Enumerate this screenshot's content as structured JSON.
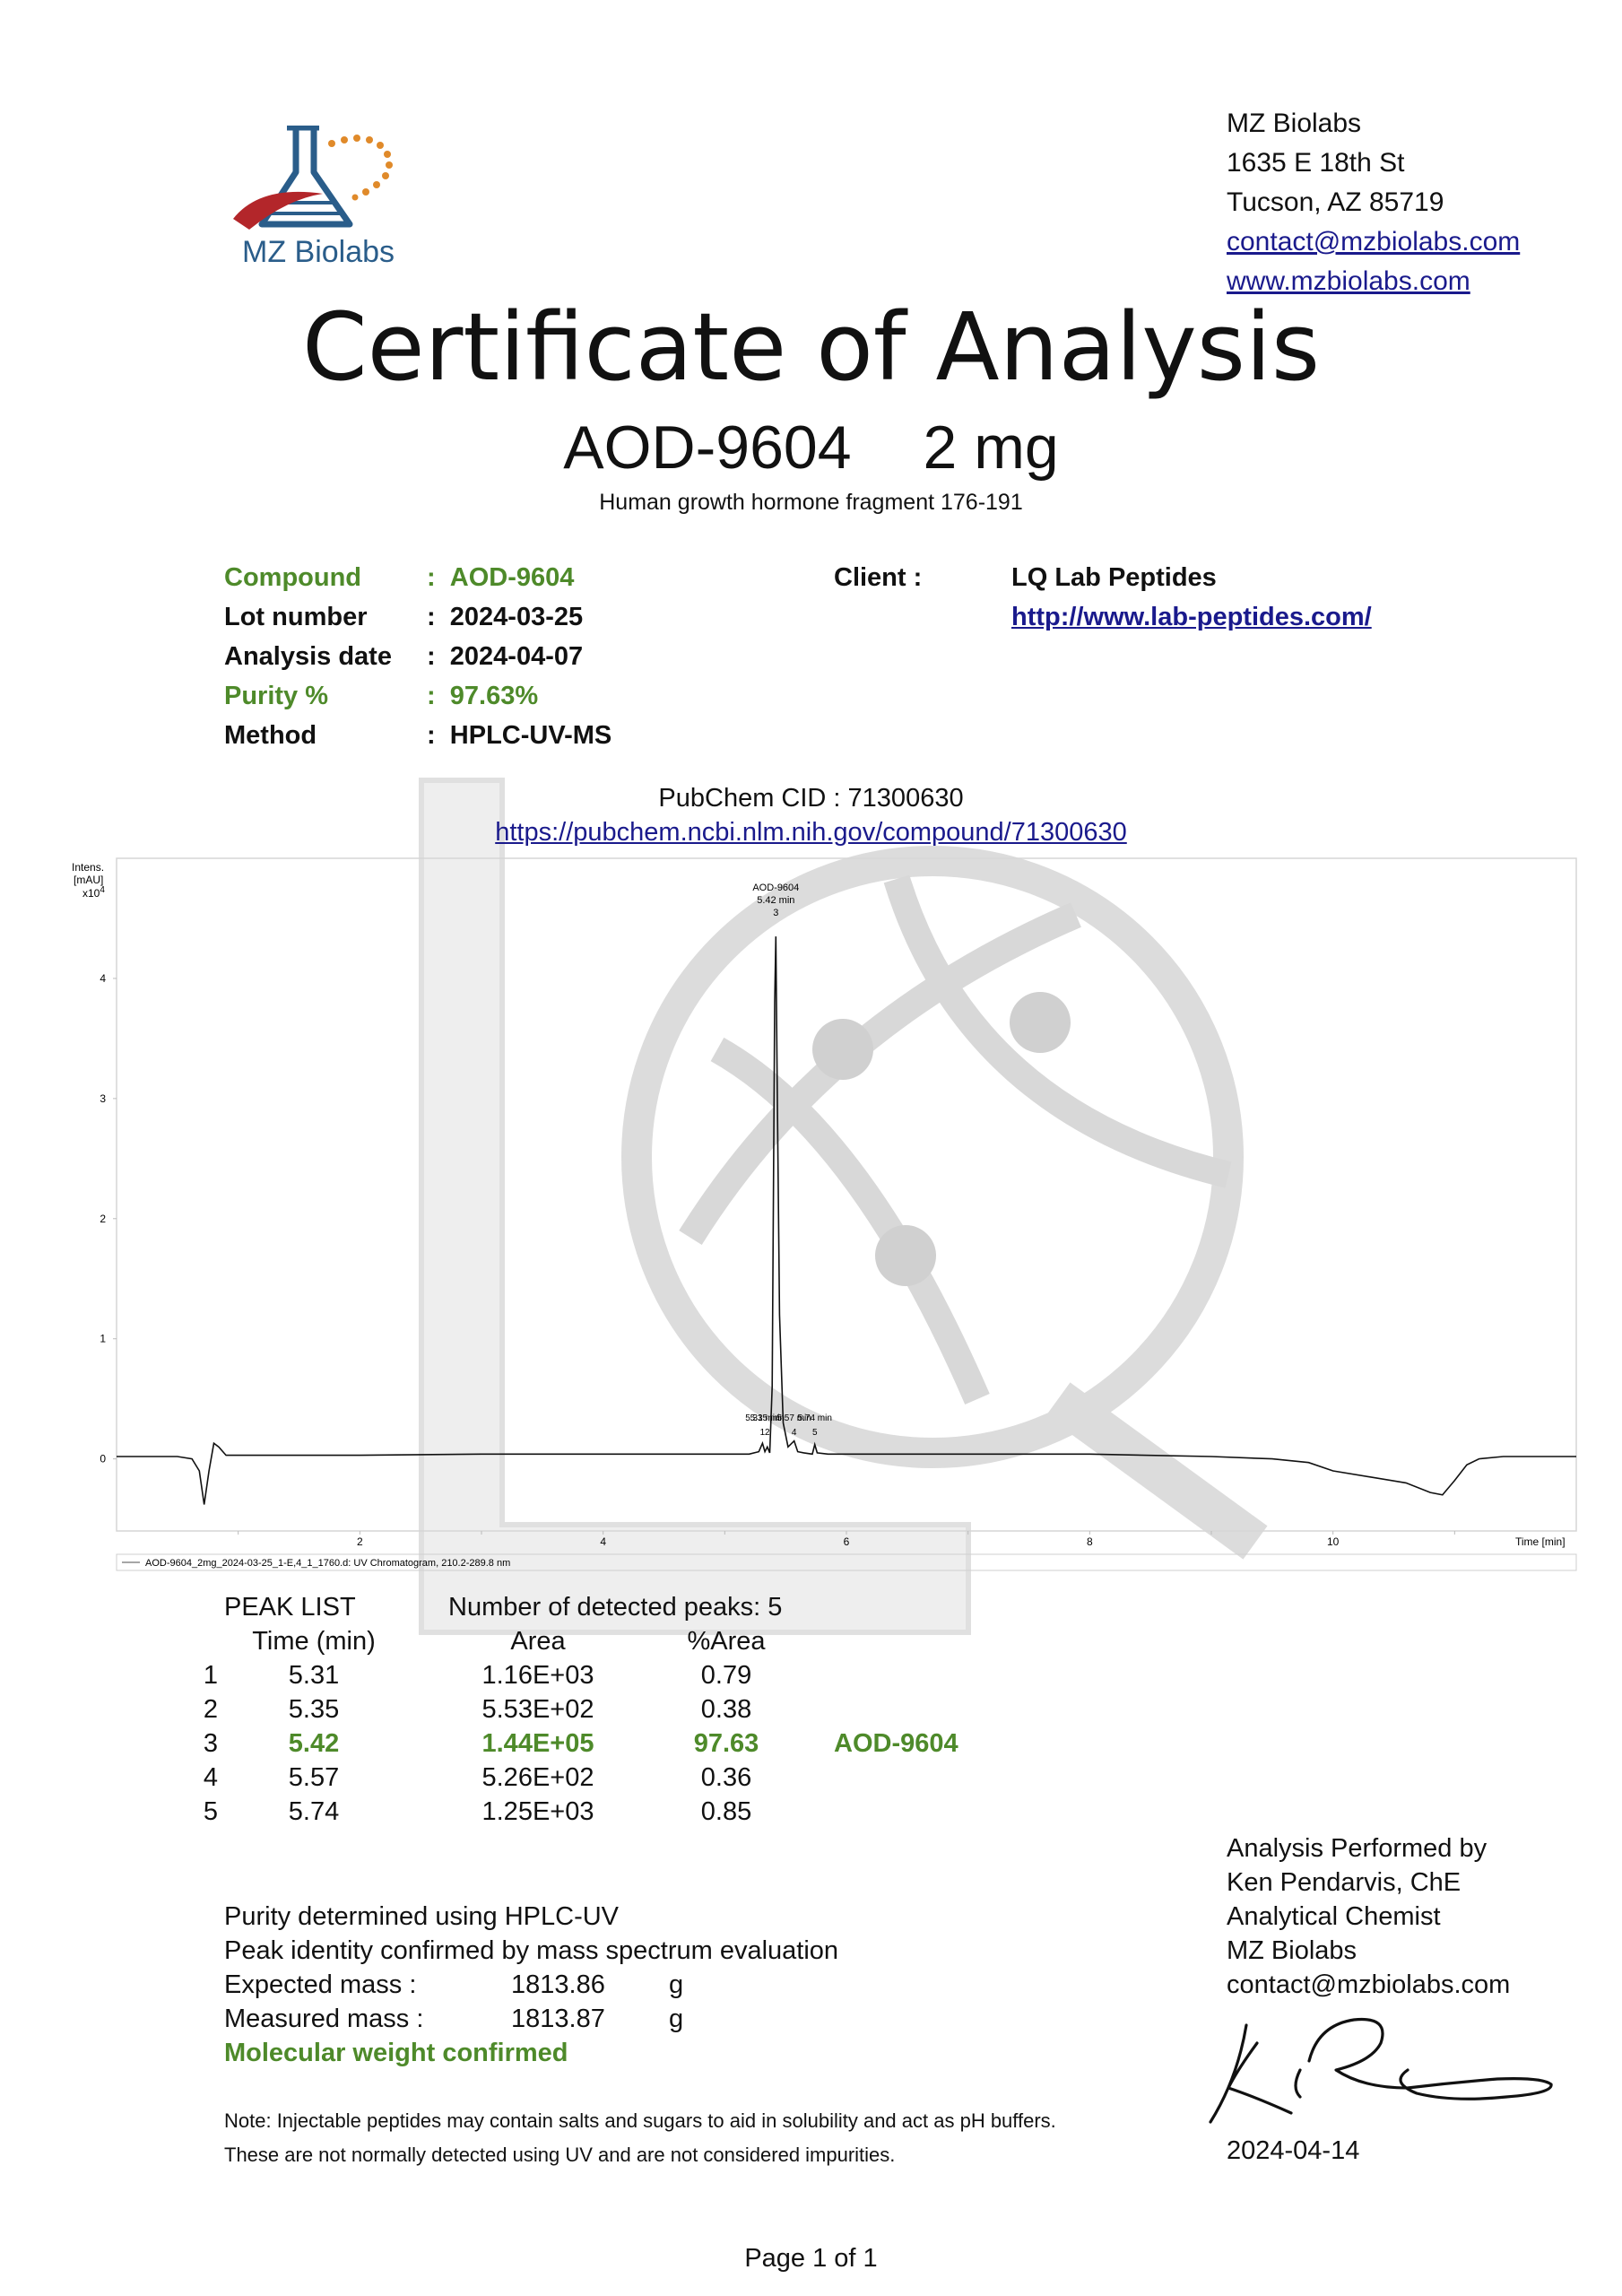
{
  "header": {
    "logo_text": "MZ Biolabs",
    "address_lines": [
      "MZ Biolabs",
      "1635 E 18th St",
      "Tucson, AZ 85719"
    ],
    "email": "contact@mzbiolabs.com",
    "website": "www.mzbiolabs.com"
  },
  "title": "Certificate of Analysis",
  "product": {
    "name": "AOD-9604",
    "amount": "2 mg"
  },
  "description": "Human growth hormone fragment 176-191",
  "info": {
    "compound_label": "Compound",
    "compound_value": "AOD-9604",
    "lot_label": "Lot number",
    "lot_value": "2024-03-25",
    "analysis_label": "Analysis date",
    "analysis_value": "2024-04-07",
    "purity_label": "Purity %",
    "purity_value": "97.63%",
    "method_label": "Method",
    "method_value": "HPLC-UV-MS",
    "separator": ":",
    "client_label": "Client :",
    "client_name": "LQ Lab Peptides",
    "client_url": "http://www.lab-peptides.com/"
  },
  "pubchem": {
    "cid_text": "PubChem CID : 71300630",
    "url": "https://pubchem.ncbi.nlm.nih.gov/compound/71300630"
  },
  "chart_data": {
    "type": "line",
    "y_unit_line1": "Intens.",
    "y_unit_line2": "[mAU]",
    "y_multiplier": "x10",
    "y_multiplier_exp": "4",
    "xlabel": "Time [min]",
    "xlim": [
      0,
      12
    ],
    "ylim": [
      -0.6,
      5.0
    ],
    "x_ticks": [
      2,
      4,
      6,
      8,
      10
    ],
    "y_ticks": [
      0,
      1,
      2,
      3,
      4
    ],
    "legend": "AOD-9604_2mg_2024-03-25_1-E,4_1_1760.d: UV Chromatogram, 210.2-289.8 nm",
    "main_peak_label": [
      "AOD-9604",
      "5.42 min",
      "3"
    ],
    "small_peak_labels": [
      {
        "text": "5.31 min",
        "num": "1",
        "x": 5.31
      },
      {
        "text": "5.35 min",
        "num": "2",
        "x": 5.35
      },
      {
        "text": "5.57 min",
        "num": "4",
        "x": 5.57
      },
      {
        "text": "5.74 min",
        "num": "5",
        "x": 5.74
      }
    ],
    "series": [
      {
        "x": [
          0,
          0.5,
          0.62,
          0.68,
          0.72,
          0.76,
          0.8,
          0.84,
          0.9,
          1.0,
          2.0,
          3.0,
          4.0,
          4.8,
          5.2,
          5.28,
          5.31,
          5.33,
          5.35,
          5.37,
          5.39,
          5.41,
          5.42,
          5.43,
          5.45,
          5.48,
          5.52,
          5.57,
          5.6,
          5.65,
          5.72,
          5.74,
          5.76,
          5.85,
          6.0,
          7.0,
          8.0,
          9.0,
          9.5,
          9.8,
          10.0,
          10.3,
          10.6,
          10.8,
          10.9,
          11.0,
          11.1,
          11.2,
          11.4,
          11.6,
          12.0
        ],
        "y": [
          0.02,
          0.02,
          0.0,
          -0.1,
          -0.38,
          -0.1,
          0.13,
          0.1,
          0.03,
          0.03,
          0.03,
          0.04,
          0.04,
          0.04,
          0.04,
          0.06,
          0.13,
          0.06,
          0.1,
          0.05,
          0.6,
          3.8,
          4.35,
          3.2,
          1.2,
          0.3,
          0.1,
          0.15,
          0.06,
          0.05,
          0.04,
          0.12,
          0.05,
          0.04,
          0.04,
          0.04,
          0.04,
          0.02,
          0.0,
          -0.03,
          -0.1,
          -0.15,
          -0.2,
          -0.28,
          -0.3,
          -0.18,
          -0.05,
          0.0,
          0.02,
          0.02,
          0.02
        ]
      }
    ]
  },
  "peak_list": {
    "title": "PEAK LIST",
    "detected": "Number of detected peaks: 5",
    "headers": {
      "time": "Time (min)",
      "area": "Area",
      "pct": "%Area"
    },
    "rows": [
      {
        "n": "1",
        "time": "5.31",
        "area": "1.16E+03",
        "pct": "0.79",
        "name": ""
      },
      {
        "n": "2",
        "time": "5.35",
        "area": "5.53E+02",
        "pct": "0.38",
        "name": ""
      },
      {
        "n": "3",
        "time": "5.42",
        "area": "1.44E+05",
        "pct": "97.63",
        "name": "AOD-9604"
      },
      {
        "n": "4",
        "time": "5.57",
        "area": "5.26E+02",
        "pct": "0.36",
        "name": ""
      },
      {
        "n": "5",
        "time": "5.74",
        "area": "1.25E+03",
        "pct": "0.85",
        "name": ""
      }
    ]
  },
  "results": {
    "line1": "Purity determined using HPLC-UV",
    "line2": "Peak identity confirmed by mass spectrum evaluation",
    "expected_label": "Expected mass :",
    "expected_value": "1813.86",
    "expected_unit": "g",
    "measured_label": "Measured mass :",
    "measured_value": "1813.87",
    "measured_unit": "g",
    "confirmation": "Molecular weight confirmed"
  },
  "note": {
    "line1": "Note: Injectable peptides may contain salts and sugars to aid in solubility and act as pH buffers.",
    "line2": "These are not normally detected using UV and are not considered impurities."
  },
  "performer": {
    "heading": "Analysis Performed by",
    "name": "Ken Pendarvis, ChE",
    "title": "Analytical Chemist",
    "org": "MZ Biolabs",
    "email": "contact@mzbiolabs.com"
  },
  "signature_date": "2024-04-14",
  "page": "Page 1 of 1",
  "colors": {
    "accent_green": "#4e8a2a",
    "link_blue": "#1a1a8c",
    "logo_blue": "#2a5d8a",
    "logo_red": "#b3262a",
    "logo_orange": "#e08a2a"
  }
}
